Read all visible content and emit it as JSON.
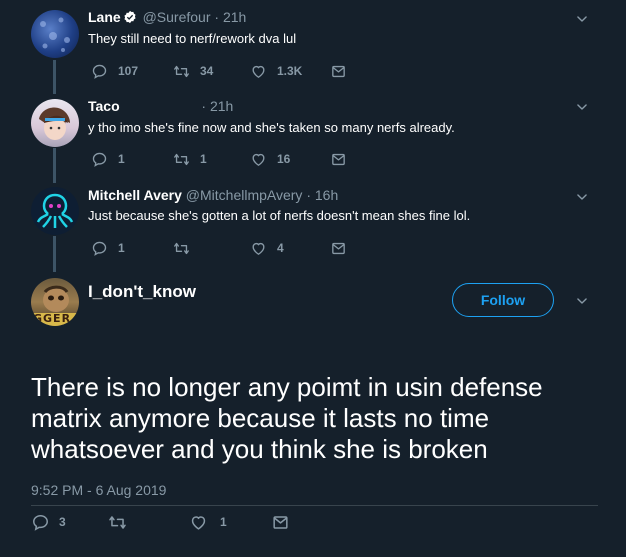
{
  "tweets": [
    {
      "name": "Lane",
      "verified": true,
      "handle": "@Surefour",
      "dot": "·",
      "time": "21h",
      "text": "They still need to nerf/rework dva lul",
      "replies": "107",
      "retweets": "34",
      "likes": "1.3K"
    },
    {
      "name": "Taco",
      "handle": "",
      "dot": "·",
      "time": "21h",
      "text": "y tho imo she's fine now and she's taken so many nerfs already.",
      "replies": "1",
      "retweets": "1",
      "likes": "16"
    },
    {
      "name": "Mitchell Avery",
      "handle": "@MitchellmpAvery",
      "dot": "·",
      "time": "16h",
      "text": "Just because she's gotten a lot of nerfs doesn't mean shes fine lol.",
      "replies": "1",
      "retweets": "",
      "likes": "4"
    }
  ],
  "main": {
    "name": "I_don't_know",
    "follow_label": "Follow",
    "text": "There is no longer any poimt in usin defense matrix anymore because it lasts no time whatsoever and you think she is broken",
    "timestamp": "9:52 PM - 6 Aug 2019",
    "replies": "3",
    "retweets": "",
    "likes": "1",
    "avatar_overlay": "GGER"
  },
  "colors": {
    "background": "#15202b",
    "muted": "#8899a6",
    "accent": "#1da1f2",
    "thread_line": "#3d5466"
  }
}
